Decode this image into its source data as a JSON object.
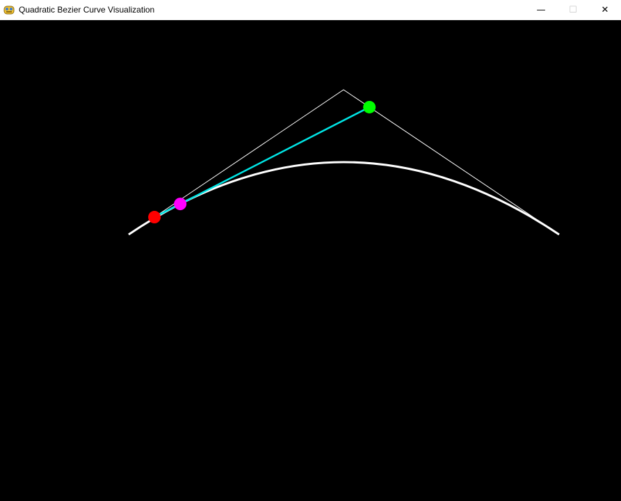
{
  "window": {
    "title": "Quadratic Bezier Curve Visualization",
    "icon": "pygame-snake-icon",
    "controls": {
      "minimize_icon": "minimize-icon",
      "maximize_icon": "maximize-icon",
      "close_icon": "close-icon",
      "minimize_glyph": "—",
      "maximize_glyph": "☐",
      "close_glyph": "✕"
    }
  },
  "scene": {
    "background": "#000000",
    "t": 0.12,
    "colors": {
      "curve": "#ffffff",
      "control_polygon": "#ffffff",
      "tangent": "#00e5e5",
      "point_on_p0p1": "#ff0000",
      "point_on_p1p2": "#00ff00",
      "point_on_curve": "#ff00ff"
    }
  }
}
